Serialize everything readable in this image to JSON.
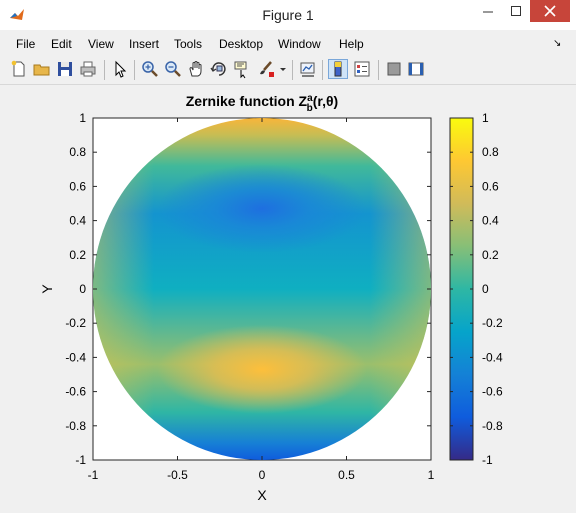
{
  "window": {
    "title": "Figure 1"
  },
  "menu": {
    "file": "File",
    "edit": "Edit",
    "view": "View",
    "insert": "Insert",
    "tools": "Tools",
    "desktop": "Desktop",
    "window": "Window",
    "help": "Help"
  },
  "toolbar": [
    "new-figure-icon",
    "open-file-icon",
    "save-icon",
    "print-icon",
    "edit-plot-arrow-icon",
    "zoom-in-icon",
    "zoom-out-icon",
    "pan-hand-icon",
    "rotate-3d-icon",
    "data-cursor-icon",
    "brush-icon",
    "link-plot-icon",
    "insert-colorbar-icon",
    "insert-legend-icon",
    "hide-plot-tools-icon",
    "show-plot-tools-icon"
  ],
  "colors": {
    "parula": [
      "#352a87",
      "#0f5cdd",
      "#1481d6",
      "#06a4ca",
      "#2eb7a4",
      "#87bf77",
      "#d1bb59",
      "#fec832",
      "#f9fb0e"
    ]
  },
  "chart_data": {
    "type": "heatmap",
    "title_main": "Zernike function Z",
    "title_sup": "a",
    "title_sub": "b",
    "title_args": "(r,θ)",
    "xlabel": "X",
    "ylabel": "Y",
    "xlim": [
      -1,
      1
    ],
    "ylim": [
      -1,
      1
    ],
    "xticks": [
      "-1",
      "-0.5",
      "0",
      "0.5",
      "1"
    ],
    "yticks": [
      "1",
      "0.8",
      "0.6",
      "0.4",
      "0.2",
      "0",
      "-0.2",
      "-0.4",
      "-0.6",
      "-0.8",
      "-1"
    ],
    "colorbar": {
      "clim": [
        -1,
        1
      ],
      "ticks": [
        "1",
        "0.8",
        "0.6",
        "0.4",
        "0.2",
        "0",
        "-0.2",
        "-0.4",
        "-0.6",
        "-0.8",
        "-1"
      ]
    },
    "field": {
      "domain": "unit disk",
      "surface_values": [
        {
          "x": 0,
          "y": 1,
          "z": 0.9
        },
        {
          "x": 0,
          "y": 0.5,
          "z": -0.6
        },
        {
          "x": 0,
          "y": 0,
          "z": 0
        },
        {
          "x": 0,
          "y": -0.5,
          "z": 0.6
        },
        {
          "x": 0,
          "y": -1,
          "z": -0.9
        },
        {
          "x": 1,
          "y": 0,
          "z": 0.1
        },
        {
          "x": -1,
          "y": 0,
          "z": 0.1
        }
      ]
    }
  }
}
